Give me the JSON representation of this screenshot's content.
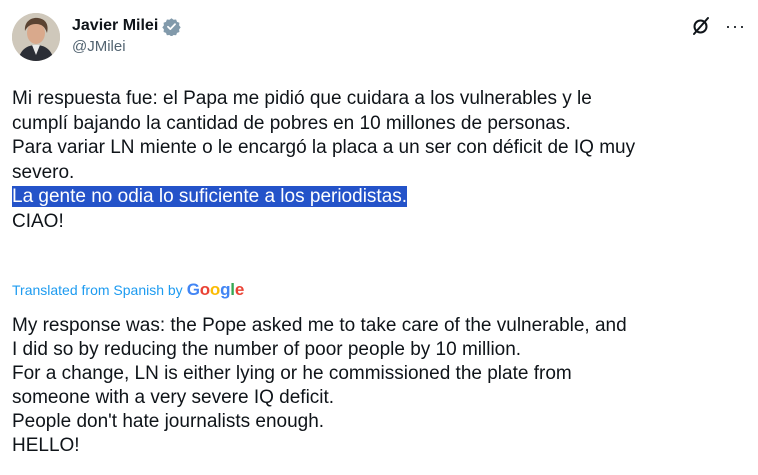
{
  "author": {
    "name": "Javier Milei",
    "handle": "@JMilei",
    "verified": true
  },
  "icons": {
    "verified": "verified-badge-icon",
    "grok": "grok-icon",
    "more": "more-icon"
  },
  "colors": {
    "highlight": "#2453c9",
    "link": "#1d9bf0",
    "verified_badge": "#829aab"
  },
  "tweet": {
    "lines": [
      "Mi respuesta fue: el Papa me pidió que cuidara a los vulnerables y le",
      "cumplí bajando la cantidad de pobres en 10 millones de personas.",
      "Para variar LN miente o le encargó la placa a un ser con déficit de IQ muy",
      "severo."
    ],
    "highlighted": "La gente no odia lo suficiente a los periodistas.",
    "closing": "CIAO!"
  },
  "translation": {
    "label": "Translated from Spanish by",
    "provider": "Google",
    "lines": [
      "My response was: the Pope asked me to take care of the vulnerable, and",
      "I did so by reducing the number of poor people by 10 million.",
      "For a change, LN is either lying or he commissioned the plate from",
      "someone with a very severe IQ deficit.",
      "People don't hate journalists enough.",
      "HELLO!"
    ]
  },
  "more_label": "···"
}
